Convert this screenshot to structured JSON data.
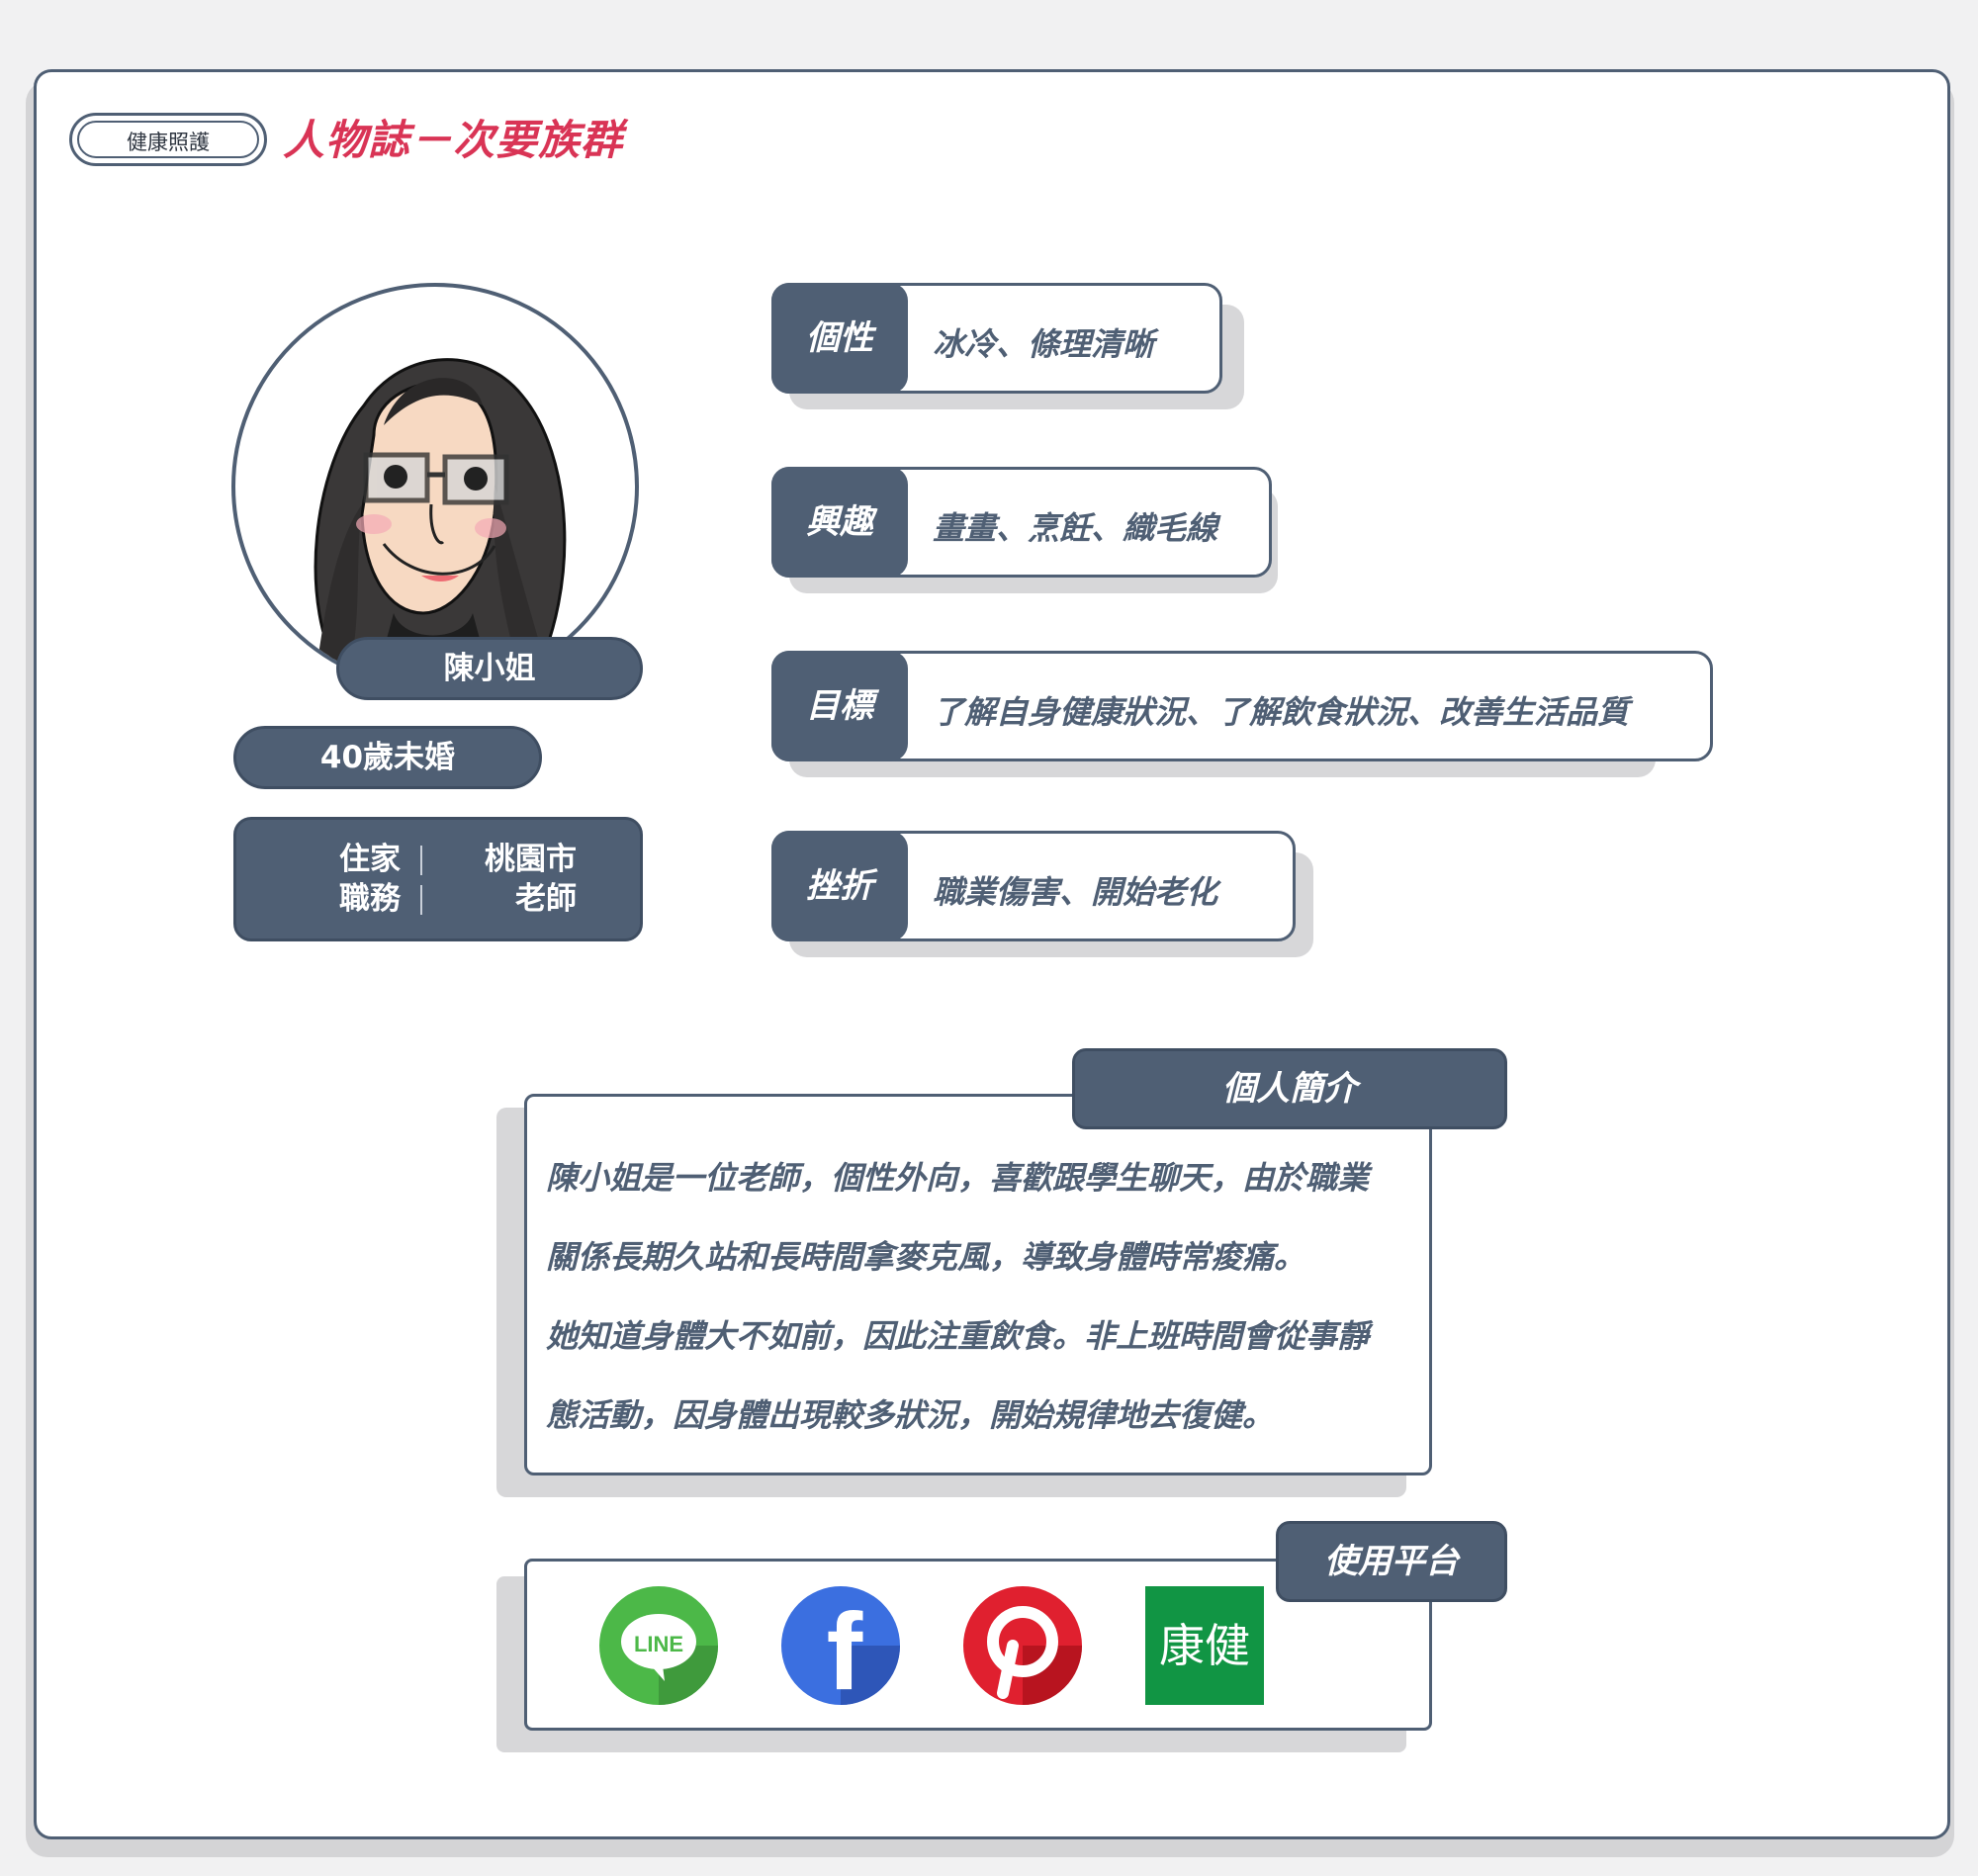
{
  "header": {
    "tag": "健康照護",
    "title": "人物誌－次要族群"
  },
  "profile": {
    "name": "陳小姐",
    "age": "40歲未婚",
    "home_label": "住家",
    "home_value": "桃園市",
    "job_label": "職務",
    "job_value": "老師"
  },
  "traits": [
    {
      "label": "個性",
      "value": "冰冷、條理清晰"
    },
    {
      "label": "興趣",
      "value": "畫畫、烹飪、織毛線"
    },
    {
      "label": "目標",
      "value": "了解自身健康狀況、了解飲食狀況、改善生活品質"
    },
    {
      "label": "挫折",
      "value": "職業傷害、開始老化"
    }
  ],
  "bio": {
    "title": "個人簡介",
    "lines": [
      "陳小姐是一位老師，個性外向，喜歡跟學生聊天，由於職業",
      "關係長期久站和長時間拿麥克風，導致身體時常痠痛。",
      "她知道身體大不如前，因此注重飲食。非上班時間會從事靜",
      "態活動，因身體出現較多狀況，開始規律地去復健。"
    ]
  },
  "platforms": {
    "title": "使用平台",
    "items": [
      {
        "name": "line-icon",
        "text": "LINE",
        "color": "#4cb848"
      },
      {
        "name": "facebook-icon",
        "text": "f",
        "color": "#3b6fe0"
      },
      {
        "name": "pinterest-icon",
        "text": "p",
        "color": "#e0202f"
      },
      {
        "name": "kangjian-icon",
        "text": "康健",
        "color": "#119544"
      }
    ]
  },
  "colors": {
    "accent": "#4f5f74",
    "title": "#d93455"
  }
}
